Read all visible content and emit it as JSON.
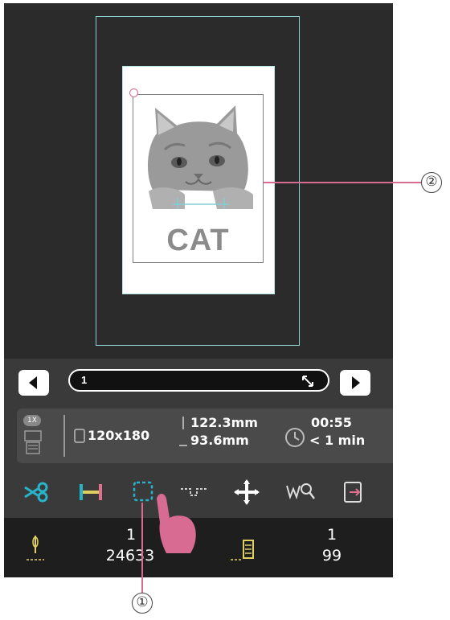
{
  "preview": {
    "design_text": "CAT"
  },
  "navigation": {
    "slider_value": "1"
  },
  "info": {
    "size_label": "120x180",
    "height": "122.3mm",
    "width": "93.6mm",
    "time": "00:55",
    "time_remaining": "< 1 min",
    "zoom_badge": "1X"
  },
  "toolbar": {
    "icons": [
      "scissors-icon",
      "color-bar-icon",
      "select-area-icon",
      "chain-stitch-icon",
      "move-icon",
      "search-color-icon",
      "exit-icon"
    ]
  },
  "status": {
    "needle_top": "1",
    "needle_bottom": "24633",
    "thread_top": "1",
    "thread_bottom": "99"
  },
  "callouts": {
    "one": "①",
    "two": "②"
  },
  "colors": {
    "accent": "#d86b92",
    "frame": "#8ecfcf",
    "icon_cyan": "#28b4c8"
  }
}
